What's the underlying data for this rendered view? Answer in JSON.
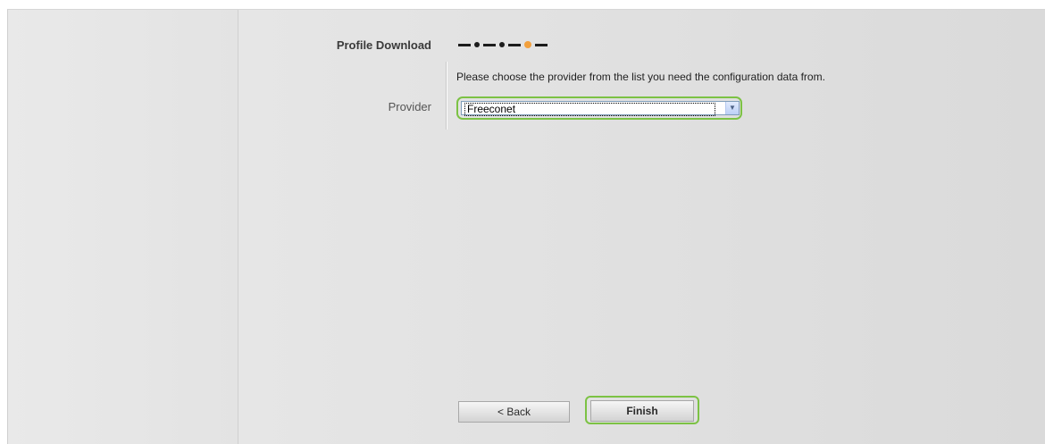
{
  "wizard": {
    "section_title": "Profile Download",
    "progress": {
      "total_steps": 4,
      "current_step": 4
    },
    "instructions": "Please choose the provider from the list you need the configuration data from.",
    "provider_field": {
      "label": "Provider",
      "selected_value": "Freeconet"
    }
  },
  "buttons": {
    "back_label": "< Back",
    "finish_label": "Finish"
  },
  "colors": {
    "highlight_outline": "#7cc244",
    "progress_active": "#f2a03d",
    "progress_inactive": "#1c1c1c"
  },
  "icons": {
    "select_arrow": "chevron-down-icon"
  }
}
